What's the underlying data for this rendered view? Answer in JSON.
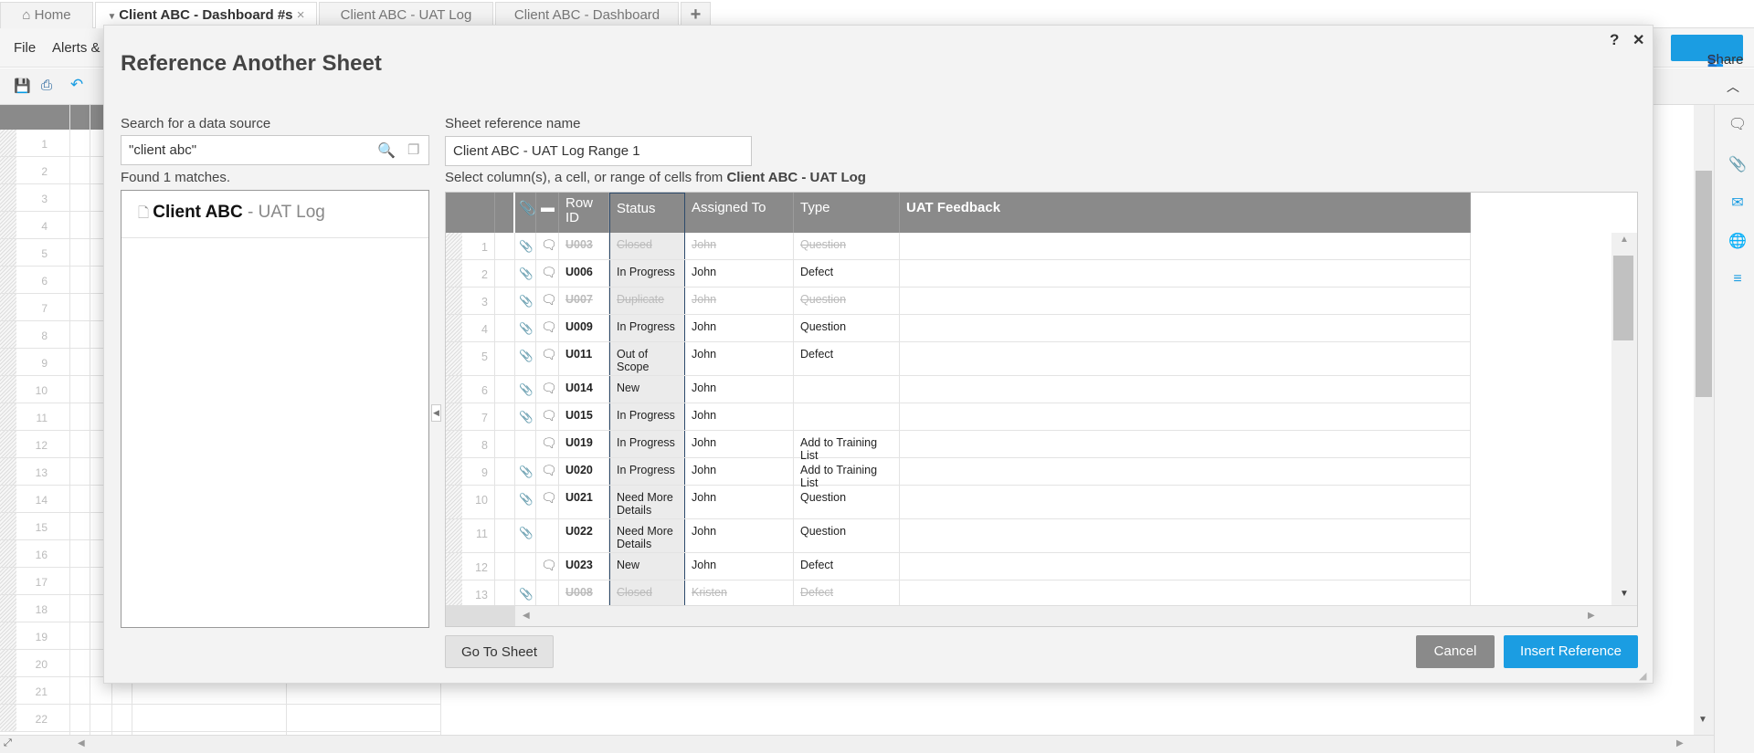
{
  "tabs": [
    {
      "label": "Home",
      "icon": "home-icon"
    },
    {
      "label": "Client ABC - Dashboard #s",
      "active": true
    },
    {
      "label": "Client ABC - UAT Log"
    },
    {
      "label": "Client ABC - Dashboard"
    }
  ],
  "tab_add": "+",
  "tab_close": "×",
  "menu": [
    "File",
    "Alerts &"
  ],
  "share_label": "Share",
  "accent": "#1b9de2",
  "background_grid_rows": [
    "1",
    "2",
    "3",
    "4",
    "5",
    "6",
    "7",
    "8",
    "9",
    "10",
    "11",
    "12",
    "13",
    "14",
    "15",
    "16",
    "17",
    "18",
    "19",
    "20",
    "21",
    "22"
  ],
  "dialog": {
    "title": "Reference Another Sheet",
    "help": "?",
    "close": "✕",
    "search_label": "Search for a data source",
    "search_value": "\"client abc\"",
    "found_text": "Found 1 matches.",
    "result": {
      "bold": "Client ABC",
      "rest": " - UAT Log"
    },
    "ref_name_label": "Sheet reference name",
    "ref_name_value": "Client ABC - UAT Log Range 1",
    "select_prefix": "Select column(s), a cell, or range of cells from ",
    "select_sheet": "Client ABC - UAT Log",
    "columns": [
      "Row ID",
      "Status",
      "Assigned To",
      "Type",
      "UAT Feedback"
    ],
    "rows": [
      {
        "n": "1",
        "id": "U003",
        "status": "Closed",
        "assigned": "John",
        "type": "Question",
        "strike": true,
        "attach": true,
        "comment": true
      },
      {
        "n": "2",
        "id": "U006",
        "status": "In Progress",
        "assigned": "John",
        "type": "Defect",
        "attach": true,
        "comment": true
      },
      {
        "n": "3",
        "id": "U007",
        "status": "Duplicate",
        "assigned": "John",
        "type": "Question",
        "strike": true,
        "attach": true,
        "comment": true
      },
      {
        "n": "4",
        "id": "U009",
        "status": "In Progress",
        "assigned": "John",
        "type": "Question",
        "attach": true,
        "comment": true
      },
      {
        "n": "5",
        "id": "U011",
        "status": "Out of Scope",
        "assigned": "John",
        "type": "Defect",
        "attach": true,
        "comment": true,
        "tall": true
      },
      {
        "n": "6",
        "id": "U014",
        "status": "New",
        "assigned": "John",
        "type": "",
        "attach": true,
        "comment": true
      },
      {
        "n": "7",
        "id": "U015",
        "status": "In Progress",
        "assigned": "John",
        "type": "",
        "attach": true,
        "comment": true
      },
      {
        "n": "8",
        "id": "U019",
        "status": "In Progress",
        "assigned": "John",
        "type": "Add to Training List",
        "comment": true
      },
      {
        "n": "9",
        "id": "U020",
        "status": "In Progress",
        "assigned": "John",
        "type": "Add to Training List",
        "attach": true,
        "comment": true
      },
      {
        "n": "10",
        "id": "U021",
        "status": "Need More Details",
        "assigned": "John",
        "type": "Question",
        "attach": true,
        "comment": true,
        "tall": true
      },
      {
        "n": "11",
        "id": "U022",
        "status": "Need More Details",
        "assigned": "John",
        "type": "Question",
        "attach": true,
        "tall": true
      },
      {
        "n": "12",
        "id": "U023",
        "status": "New",
        "assigned": "John",
        "type": "Defect",
        "comment": true
      },
      {
        "n": "13",
        "id": "U008",
        "status": "Closed",
        "assigned": "Kristen",
        "type": "Defect",
        "strike": true,
        "attach": true
      }
    ],
    "go_to_sheet": "Go To Sheet",
    "cancel": "Cancel",
    "insert": "Insert Reference"
  }
}
